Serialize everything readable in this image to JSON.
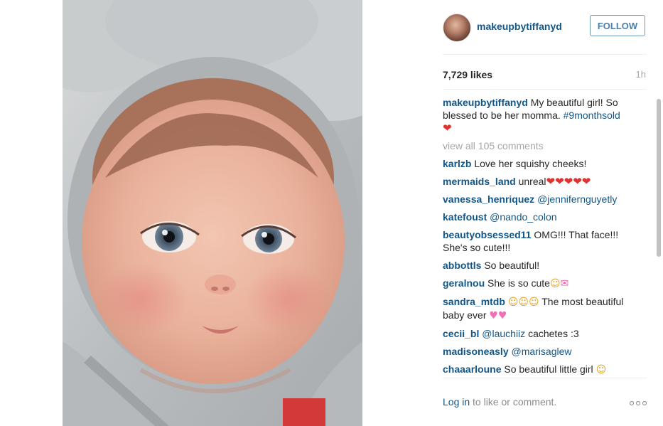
{
  "post": {
    "author": "makeupbytiffanyd",
    "follow_label": "FOLLOW",
    "likes": "7,729 likes",
    "time": "1h",
    "caption_user": "makeupbytiffanyd",
    "caption_text": "My beautiful girl! So blessed to be her momma.",
    "caption_tag": "#9monthsold",
    "view_all": "view all 105 comments"
  },
  "comments": [
    {
      "user": "karlzb",
      "text": "Love her squishy cheeks!"
    },
    {
      "user": "mermaids_land",
      "text": "unreal"
    },
    {
      "user": "vanessa_henriquez",
      "mention": "@jennifernguyetly"
    },
    {
      "user": "katefoust",
      "mention": "@nando_colon"
    },
    {
      "user": "beautyobsessed11",
      "text": "OMG!!! That face!!! She's so cute!!!"
    },
    {
      "user": "abbottls",
      "text": "So beautiful!"
    },
    {
      "user": "geralnou",
      "text": "She is so cute"
    },
    {
      "user": "sandra_mtdb",
      "text": "The most beautiful baby ever"
    },
    {
      "user": "cecii_bl",
      "mention": "@lauchiiz",
      "text": "cachetes :3"
    },
    {
      "user": "madisoneasly",
      "mention": "@marisaglew"
    },
    {
      "user": "chaaarloune",
      "text": "So beautiful little girl"
    }
  ],
  "footer": {
    "login": "Log in",
    "login_rest": "to like or comment."
  },
  "icons": [
    "heart-emoji",
    "heart-eyes-emoji",
    "heart-letter-emoji",
    "two-hearts-emoji",
    "more-options-icon"
  ]
}
